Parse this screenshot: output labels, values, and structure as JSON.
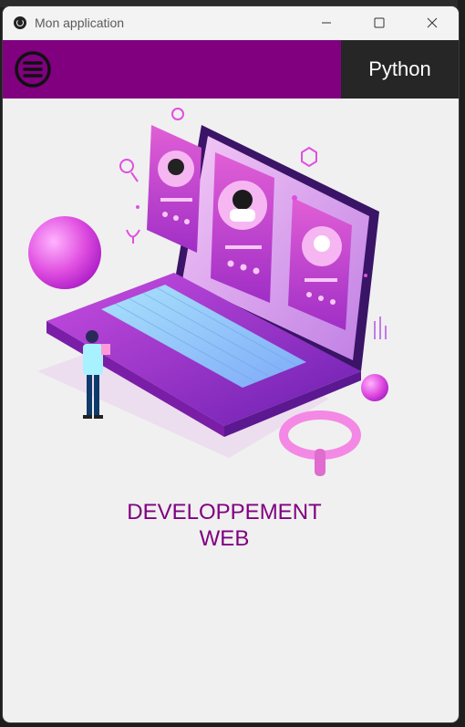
{
  "window": {
    "title": "Mon application",
    "minimize_icon": "minimize-icon",
    "maximize_icon": "maximize-icon",
    "close_icon": "close-icon"
  },
  "appbar": {
    "menu_icon": "hamburger-menu-icon",
    "tab_label": "Python",
    "accent_color": "#800080",
    "tab_color": "#262626"
  },
  "main": {
    "caption_line1": "DEVELOPPEMENT",
    "caption_line2": "WEB",
    "caption_color": "#800080",
    "illustration": "laptop-web-development-illustration"
  }
}
